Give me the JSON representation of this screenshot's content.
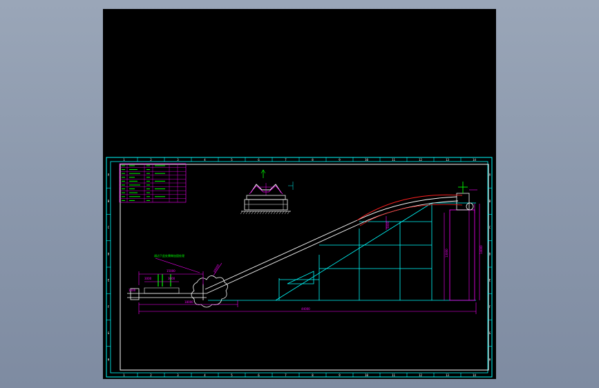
{
  "drawing": {
    "column_labels": [
      "1",
      "2",
      "3",
      "4",
      "5",
      "6",
      "7",
      "8",
      "9",
      "10",
      "11",
      "12",
      "13",
      "14"
    ],
    "row_labels": [
      "A",
      "B",
      "C",
      "D",
      "E",
      "F",
      "G",
      "H"
    ],
    "annotation_note": "裙边下此处需做加固处理",
    "dimensions": {
      "total_length": "44000",
      "horizontal_run": "18000",
      "feed_section": "15000",
      "feed_left": "3000",
      "feed_right": "3000",
      "rise_height": "13000",
      "head_height": "14000",
      "incline_dim": "20000",
      "tail_dim": "1000",
      "side_dim": "5000"
    },
    "colors": {
      "frame": "#00ffff",
      "border": "#ffffff",
      "belt": "#ffffff",
      "belt_top": "#ff2020",
      "dimension": "#ff00ff",
      "structure": "#ffffff",
      "table_text": "#00ff00",
      "title_block": "#ff00ff",
      "note": "#00ff00"
    }
  }
}
